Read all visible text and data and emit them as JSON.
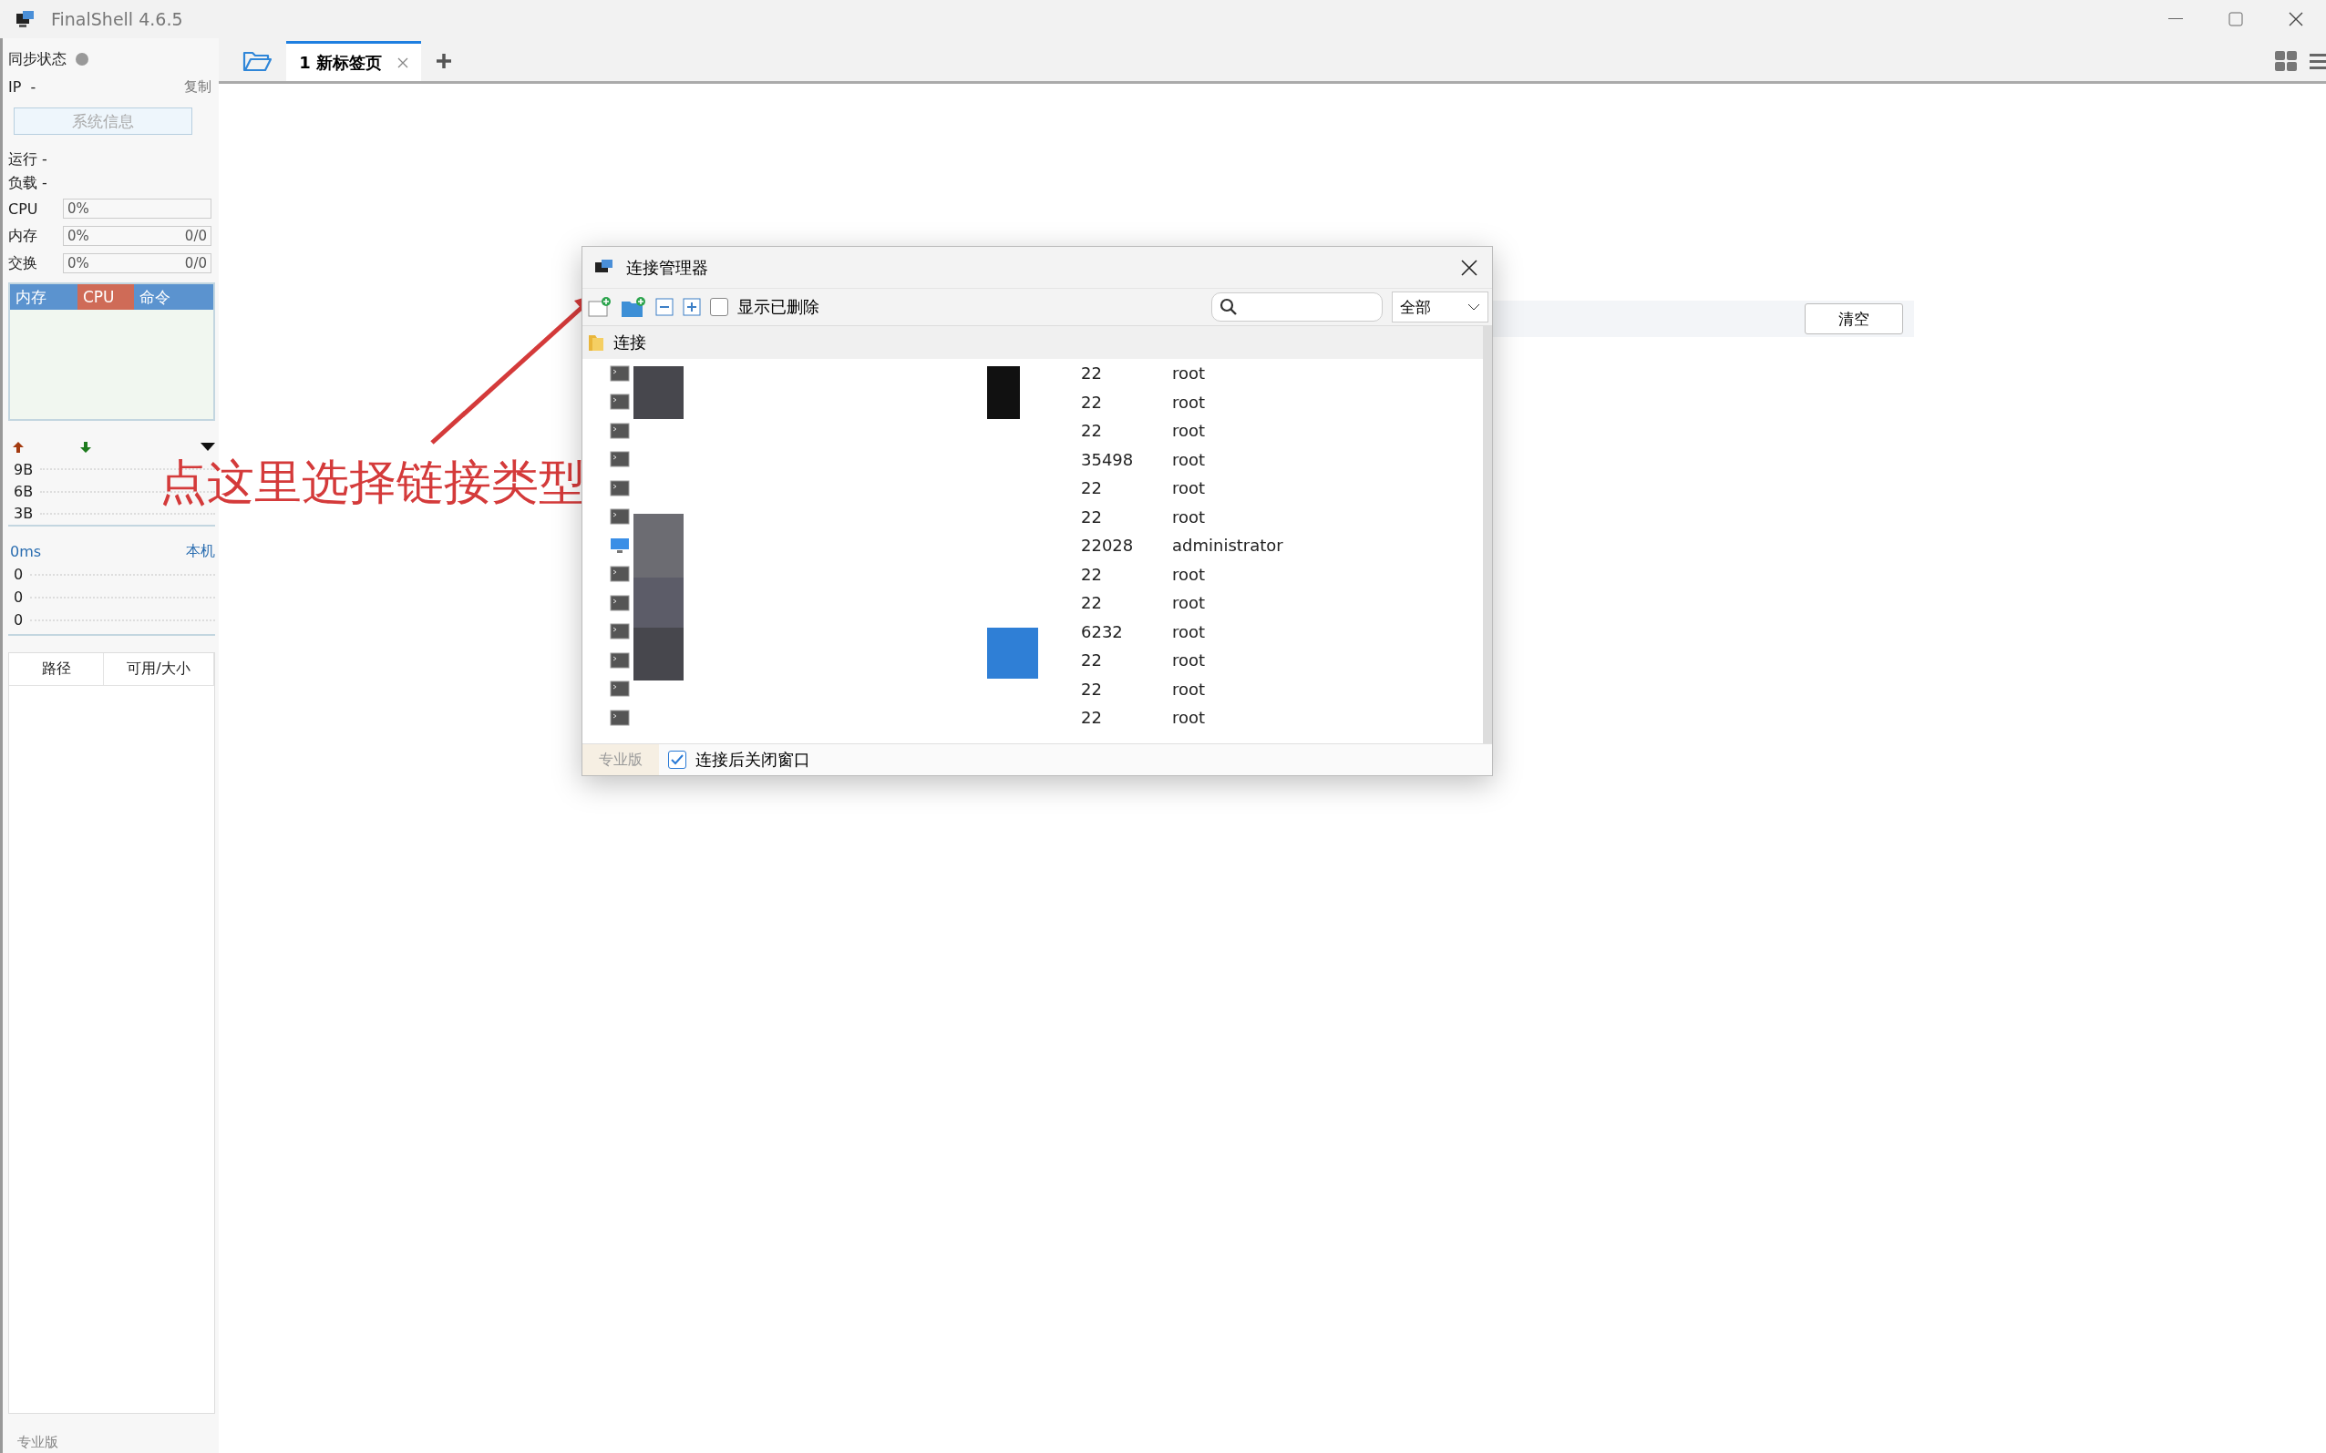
{
  "window": {
    "title": "FinalShell 4.6.5"
  },
  "sidebar": {
    "sync_label": "同步状态",
    "sync_on": false,
    "ip_label": "IP",
    "ip_value": "-",
    "copy": "复制",
    "sysinfo_button": "系统信息",
    "run_label": "运行 -",
    "load_label": "负载 -",
    "meters": [
      {
        "label": "CPU",
        "reading": "0%",
        "level": 0
      },
      {
        "label": "内存",
        "reading": "0%",
        "total": "0/0",
        "level": 0
      },
      {
        "label": "交换",
        "reading": "0%",
        "total": "0/0",
        "level": 0
      }
    ],
    "monitor_tabs": [
      {
        "label": "内存",
        "selected": false
      },
      {
        "label": "CPU",
        "selected": true
      },
      {
        "label": "命令",
        "selected": false
      }
    ],
    "net_ticks": [
      "9B",
      "6B",
      "3B"
    ],
    "ping": {
      "latency": "0ms",
      "target": "本机",
      "ticks": [
        "0",
        "0",
        "0"
      ]
    },
    "disk_columns": [
      "路径",
      "可用/大小"
    ],
    "edition": "专业版"
  },
  "tabs": [
    {
      "label": "1 新标签页",
      "selected": true
    }
  ],
  "clear_button": "清空",
  "annotation": "点这里选择链接类型",
  "dialog": {
    "title": "连接管理器",
    "show_deleted_label": "显示已删除",
    "show_deleted": false,
    "filter": "全部",
    "folder": "连接",
    "rows": [
      {
        "kind": "ssh",
        "port": "22",
        "user": "root"
      },
      {
        "kind": "ssh",
        "port": "22",
        "user": "root"
      },
      {
        "kind": "ssh",
        "port": "22",
        "user": "root"
      },
      {
        "kind": "ssh",
        "port": "35498",
        "user": "root"
      },
      {
        "kind": "ssh",
        "port": "22",
        "user": "root"
      },
      {
        "kind": "ssh",
        "port": "22",
        "user": "root"
      },
      {
        "kind": "rdp",
        "port": "22028",
        "user": "administrator"
      },
      {
        "kind": "ssh",
        "port": "22",
        "user": "root"
      },
      {
        "kind": "ssh",
        "port": "22",
        "user": "root"
      },
      {
        "kind": "ssh",
        "port": "6232",
        "user": "root"
      },
      {
        "kind": "ssh",
        "port": "22",
        "user": "root"
      },
      {
        "kind": "ssh",
        "port": "22",
        "user": "root"
      },
      {
        "kind": "ssh",
        "port": "22",
        "user": "root"
      }
    ],
    "edition": "专业版",
    "close_after_connect_label": "连接后关闭窗口",
    "close_after_connect": true
  }
}
